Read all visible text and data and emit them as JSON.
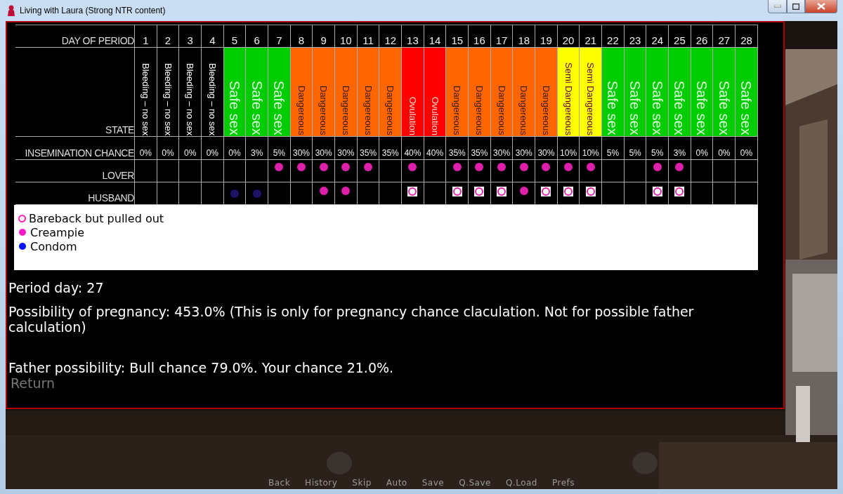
{
  "window": {
    "title": "Living with Laura (Strong NTR content)"
  },
  "chart": {
    "header_label": "DAY OF PERIOD",
    "state_label": "STATE",
    "chance_label": "INSEMINATION CHANCE",
    "lover_label": "LOVER",
    "husband_label": "HUSBAND",
    "days": [
      {
        "day": "1",
        "state": "Bleeding – no sex",
        "kind": "bleeding",
        "chance": "0%"
      },
      {
        "day": "2",
        "state": "Bleeding – no sex",
        "kind": "bleeding",
        "chance": "0%"
      },
      {
        "day": "3",
        "state": "Bleeding – no sex",
        "kind": "bleeding",
        "chance": "0%"
      },
      {
        "day": "4",
        "state": "Bleeding – no sex",
        "kind": "bleeding",
        "chance": "0%"
      },
      {
        "day": "5",
        "state": "Safe sex",
        "kind": "safe",
        "chance": "0%",
        "husband": {
          "kind": "condom"
        }
      },
      {
        "day": "6",
        "state": "Safe sex",
        "kind": "safe",
        "chance": "3%",
        "husband": {
          "kind": "condom"
        }
      },
      {
        "day": "7",
        "state": "Safe sex",
        "kind": "safe",
        "chance": "5%",
        "lover": {
          "kind": "creampie"
        }
      },
      {
        "day": "8",
        "state": "Dangereous",
        "kind": "dangerous",
        "chance": "30%",
        "lover": {
          "kind": "creampie"
        }
      },
      {
        "day": "9",
        "state": "Dangereous",
        "kind": "dangerous",
        "chance": "30%",
        "lover": {
          "kind": "creampie"
        },
        "husband": {
          "kind": "creampie"
        }
      },
      {
        "day": "10",
        "state": "Dangereous",
        "kind": "dangerous",
        "chance": "30%",
        "lover": {
          "kind": "creampie"
        },
        "husband": {
          "kind": "creampie"
        }
      },
      {
        "day": "11",
        "state": "Dangereous",
        "kind": "dangerous",
        "chance": "35%",
        "lover": {
          "kind": "creampie"
        }
      },
      {
        "day": "12",
        "state": "Dangereous",
        "kind": "dangerous",
        "chance": "35%"
      },
      {
        "day": "13",
        "state": "Ovulation",
        "kind": "ovulation",
        "chance": "40%",
        "lover": {
          "kind": "creampie"
        },
        "husband": {
          "kind": "pulled_out"
        }
      },
      {
        "day": "14",
        "state": "Ovulation",
        "kind": "ovulation",
        "chance": "40%"
      },
      {
        "day": "15",
        "state": "Dangereous",
        "kind": "dangerous",
        "chance": "35%",
        "lover": {
          "kind": "creampie"
        },
        "husband": {
          "kind": "pulled_out"
        }
      },
      {
        "day": "16",
        "state": "Dangereous",
        "kind": "dangerous",
        "chance": "35%",
        "lover": {
          "kind": "creampie"
        },
        "husband": {
          "kind": "pulled_out"
        }
      },
      {
        "day": "17",
        "state": "Dangereous",
        "kind": "dangerous",
        "chance": "30%",
        "lover": {
          "kind": "creampie"
        },
        "husband": {
          "kind": "pulled_out"
        }
      },
      {
        "day": "18",
        "state": "Dangereous",
        "kind": "dangerous",
        "chance": "30%",
        "lover": {
          "kind": "creampie"
        },
        "husband": {
          "kind": "creampie"
        }
      },
      {
        "day": "19",
        "state": "Dangereous",
        "kind": "dangerous",
        "chance": "30%",
        "lover": {
          "kind": "creampie"
        },
        "husband": {
          "kind": "pulled_out"
        }
      },
      {
        "day": "20",
        "state": "Semi Dangereous",
        "kind": "semi",
        "chance": "10%",
        "lover": {
          "kind": "creampie"
        },
        "husband": {
          "kind": "pulled_out"
        }
      },
      {
        "day": "21",
        "state": "Semi Dangereous",
        "kind": "semi",
        "chance": "10%",
        "lover": {
          "kind": "creampie"
        },
        "husband": {
          "kind": "pulled_out"
        }
      },
      {
        "day": "22",
        "state": "Safe sex",
        "kind": "safe",
        "chance": "5%"
      },
      {
        "day": "23",
        "state": "Safe sex",
        "kind": "safe",
        "chance": "5%"
      },
      {
        "day": "24",
        "state": "Safe sex",
        "kind": "safe",
        "chance": "5%",
        "lover": {
          "kind": "creampie"
        },
        "husband": {
          "kind": "pulled_out"
        }
      },
      {
        "day": "25",
        "state": "Safe sex",
        "kind": "safe",
        "chance": "3%",
        "lover": {
          "kind": "creampie"
        },
        "husband": {
          "kind": "pulled_out"
        }
      },
      {
        "day": "26",
        "state": "Safe sex",
        "kind": "safe",
        "chance": "0%"
      },
      {
        "day": "27",
        "state": "Safe sex",
        "kind": "safe",
        "chance": "0%"
      },
      {
        "day": "28",
        "state": "Safe sex",
        "kind": "safe",
        "chance": "0%"
      }
    ]
  },
  "legend": [
    {
      "kind": "pulled_out",
      "label": "Bareback but pulled out"
    },
    {
      "kind": "creampie",
      "label": "Creampie"
    },
    {
      "kind": "condom",
      "label": "Condom"
    }
  ],
  "info": [
    "Period day: 27",
    "Possibility of pregnancy: 453.0% (This is only for pregnancy chance claculation. Not for possible father calculation)",
    "Father possibility: Bull chance 79.0%. Your chance 21.0%."
  ],
  "return_button": "Return",
  "quick_menu": [
    "Back",
    "History",
    "Skip",
    "Auto",
    "Save",
    "Q.Save",
    "Q.Load",
    "Prefs"
  ]
}
